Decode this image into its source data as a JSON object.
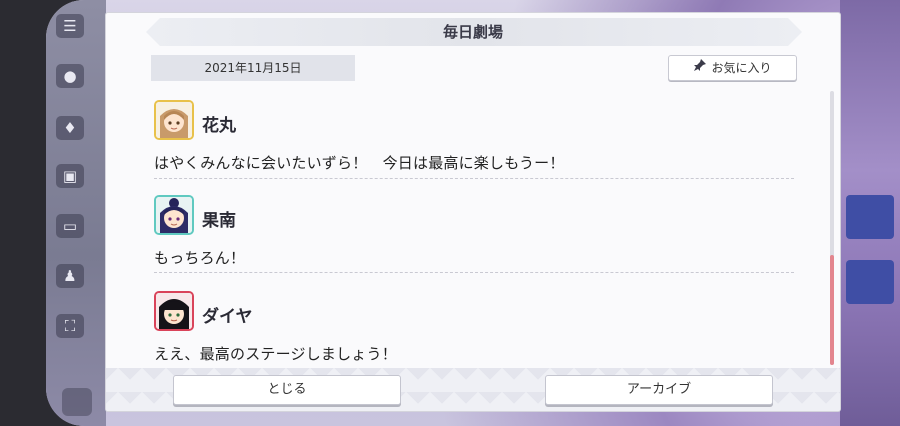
{
  "dialog": {
    "title": "毎日劇場",
    "date": "2021年11月15日",
    "favorite_label": "お気に入り",
    "favorite_icon": "pin-icon"
  },
  "entries": [
    {
      "name": "花丸",
      "line": "はやくみんなに会いたいずら！　今日は最高に楽しもうー！",
      "frame_color": "#e8c14a"
    },
    {
      "name": "果南",
      "line": "もっちろん！",
      "frame_color": "#5fc9c0"
    },
    {
      "name": "ダイヤ",
      "line": "ええ、最高のステージしましょう！",
      "frame_color": "#d9435a"
    }
  ],
  "buttons": {
    "close_label": "とじる",
    "archive_label": "アーカイブ"
  },
  "scroll": {
    "position_fraction": 1.0
  }
}
